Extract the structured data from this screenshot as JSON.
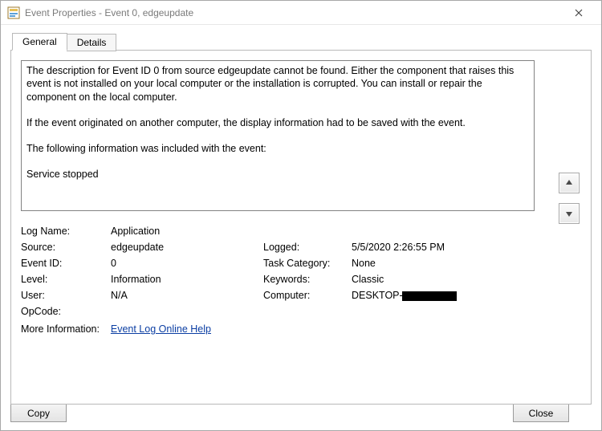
{
  "window": {
    "title": "Event Properties - Event 0, edgeupdate"
  },
  "tabs": {
    "general": "General",
    "details": "Details"
  },
  "description": {
    "line1": "The description for Event ID 0 from source edgeupdate cannot be found. Either the component that raises this event is not installed on your local computer or the installation is corrupted. You can install or repair the component on the local computer.",
    "line2": "If the event originated on another computer, the display information had to be saved with the event.",
    "line3": "The following information was included with the event:",
    "line4": "Service stopped"
  },
  "fields": {
    "log_name_label": "Log Name:",
    "log_name_value": "Application",
    "source_label": "Source:",
    "source_value": "edgeupdate",
    "logged_label": "Logged:",
    "logged_value": "5/5/2020 2:26:55 PM",
    "event_id_label": "Event ID:",
    "event_id_value": "0",
    "task_category_label": "Task Category:",
    "task_category_value": "None",
    "level_label": "Level:",
    "level_value": "Information",
    "keywords_label": "Keywords:",
    "keywords_value": "Classic",
    "user_label": "User:",
    "user_value": "N/A",
    "computer_label": "Computer:",
    "computer_value": "DESKTOP-",
    "opcode_label": "OpCode:",
    "opcode_value": "",
    "more_info_label": "More Information:",
    "more_info_link": "Event Log Online Help"
  },
  "buttons": {
    "copy": "Copy",
    "close": "Close"
  }
}
